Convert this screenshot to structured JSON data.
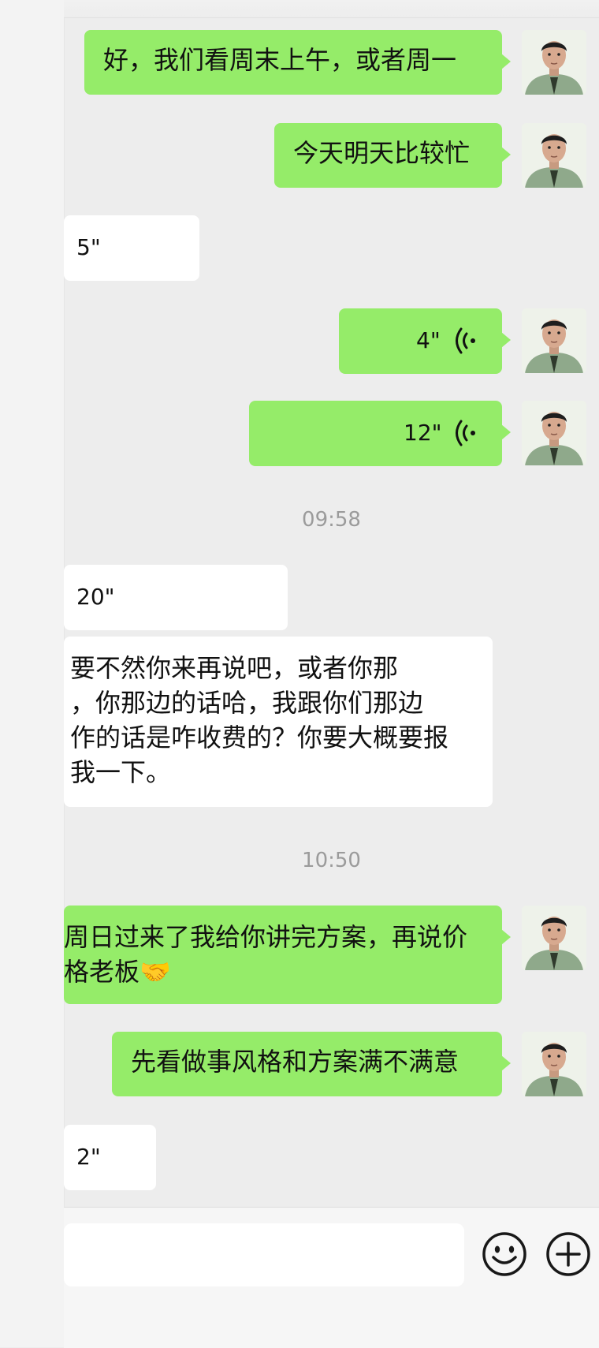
{
  "messages": [
    {
      "type": "text",
      "side": "sent",
      "text": "好，我们看周末上午，或者周一"
    },
    {
      "type": "text",
      "side": "sent",
      "text": "今天明天比较忙"
    },
    {
      "type": "voice",
      "side": "recv",
      "duration": "5\""
    },
    {
      "type": "voice",
      "side": "sent",
      "duration": "4\""
    },
    {
      "type": "voice",
      "side": "sent",
      "duration": "12\""
    },
    {
      "type": "time",
      "text": "09:58"
    },
    {
      "type": "voice",
      "side": "recv",
      "duration": "20\""
    },
    {
      "type": "text",
      "side": "recv",
      "lines": [
        "要不然你来再说吧，或者你那",
        "，你那边的话哈，我跟你们那边",
        "作的话是咋收费的？你要大概要报",
        "我一下。"
      ]
    },
    {
      "type": "time",
      "text": "10:50"
    },
    {
      "type": "text",
      "side": "sent",
      "lines": [
        "周日过来了我给你讲完方案，再说价",
        "格老板🤝"
      ]
    },
    {
      "type": "text",
      "side": "sent",
      "text": "先看做事风格和方案满不满意"
    },
    {
      "type": "voice",
      "side": "recv",
      "duration": "2\""
    }
  ],
  "colors": {
    "sent_bubble": "#95ec69",
    "recv_bubble": "#ffffff",
    "background": "#ededed",
    "timestamp": "#9b9b9b"
  },
  "icons": {
    "voice": "voice-wave-icon",
    "emoji": "emoji-smile-icon",
    "more": "plus-circle-icon",
    "avatar": "user-avatar"
  }
}
